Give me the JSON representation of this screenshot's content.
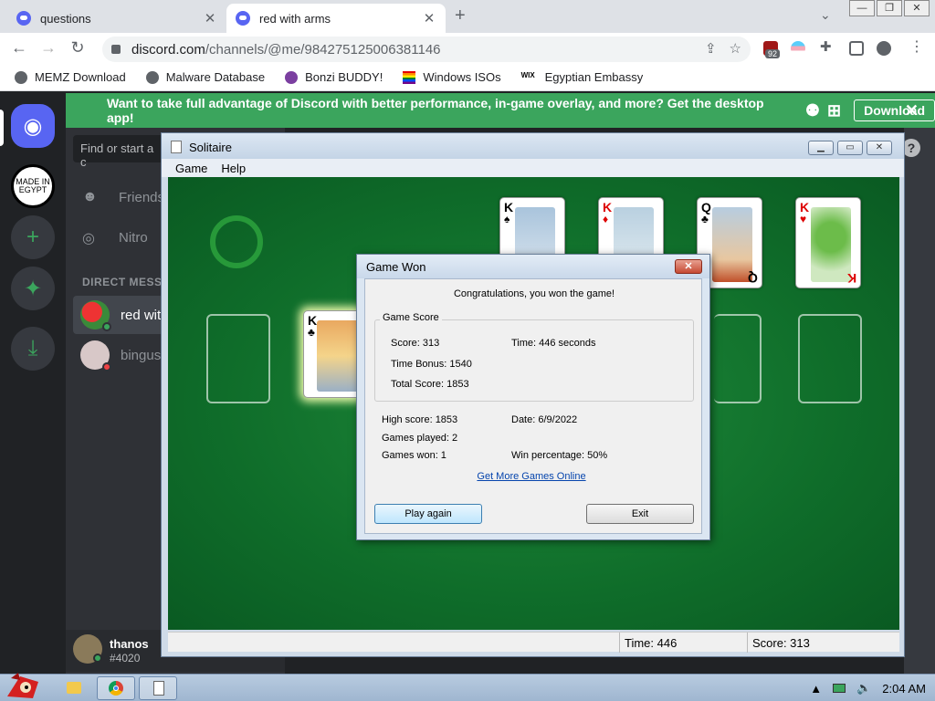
{
  "browser": {
    "tabs": [
      {
        "title": "questions"
      },
      {
        "title": "red with arms"
      }
    ],
    "address": {
      "domain": "discord.com",
      "path": "/channels/@me/984275125006381146"
    },
    "extension_badge": "92",
    "bookmarks": [
      "MEMZ Download",
      "Malware Database",
      "Bonzi BUDDY!",
      "Windows ISOs",
      "Egyptian Embassy"
    ]
  },
  "discord": {
    "banner": {
      "message": "Want to take full advantage of Discord with better performance, in-game overlay, and more? Get the desktop app!",
      "download_label": "Download"
    },
    "search_placeholder": "Find or start a c",
    "nav": {
      "friends": "Friends",
      "nitro": "Nitro"
    },
    "dm_header": "DIRECT MESSA",
    "dms": [
      {
        "name": "red wit",
        "status_color": "#3ba55d"
      },
      {
        "name": "bingus",
        "status_color": "#ed4245"
      }
    ],
    "user": {
      "name": "thanos",
      "tag": "#4020"
    },
    "egypt_badge": "MADE IN EGYPT"
  },
  "solitaire": {
    "title": "Solitaire",
    "menu": [
      "Game",
      "Help"
    ],
    "foundation": [
      {
        "rank": "K",
        "suit": "♠",
        "color": "blk"
      },
      {
        "rank": "K",
        "suit": "♦",
        "color": "red"
      },
      {
        "rank": "Q",
        "suit": "♣",
        "color": "blk"
      },
      {
        "rank": "K",
        "suit": "♥",
        "color": "red"
      }
    ],
    "moving_card": {
      "rank": "K",
      "suit": "♣"
    },
    "status": {
      "time": "Time:  446",
      "score": "Score: 313"
    }
  },
  "dialog": {
    "title": "Game Won",
    "congrats": "Congratulations, you won the game!",
    "group_label": "Game Score",
    "score": "Score: 313",
    "time": "Time:  446 seconds",
    "time_bonus": "Time Bonus: 1540",
    "total_score": "Total Score: 1853",
    "high_score": "High score: 1853",
    "date": "Date: 6/9/2022",
    "games_played": "Games played: 2",
    "games_won": "Games won: 1",
    "win_percentage": "Win percentage: 50%",
    "link": "Get More Games Online",
    "play_again": "Play again",
    "exit": "Exit"
  },
  "taskbar": {
    "clock": "2:04 AM"
  }
}
